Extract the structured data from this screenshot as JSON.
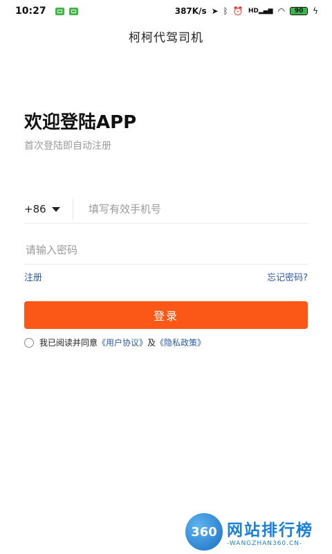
{
  "status_bar": {
    "time": "10:27",
    "net_speed": "387K/s",
    "signal_label": "HD",
    "battery": "90"
  },
  "header": {
    "title": "柯柯代驾司机"
  },
  "welcome": {
    "heading": "欢迎登陆APP",
    "subtitle": "首次登陆即自动注册"
  },
  "phone": {
    "country_code": "+86",
    "placeholder": "填写有效手机号"
  },
  "password": {
    "placeholder": "请输入密码"
  },
  "links": {
    "register": "注册",
    "forgot": "忘记密码?"
  },
  "login_button": "登录",
  "agreement": {
    "prefix": "我已阅读并同意",
    "user_agreement": "《用户协议》",
    "and": "及",
    "privacy_policy": "《隐私政策》"
  },
  "watermark": {
    "logo": "360",
    "main": "网站排行榜",
    "sub": "-WANGZHAN360.CN-"
  },
  "colors": {
    "accent": "#fb5716",
    "link": "#2c5aa0"
  }
}
